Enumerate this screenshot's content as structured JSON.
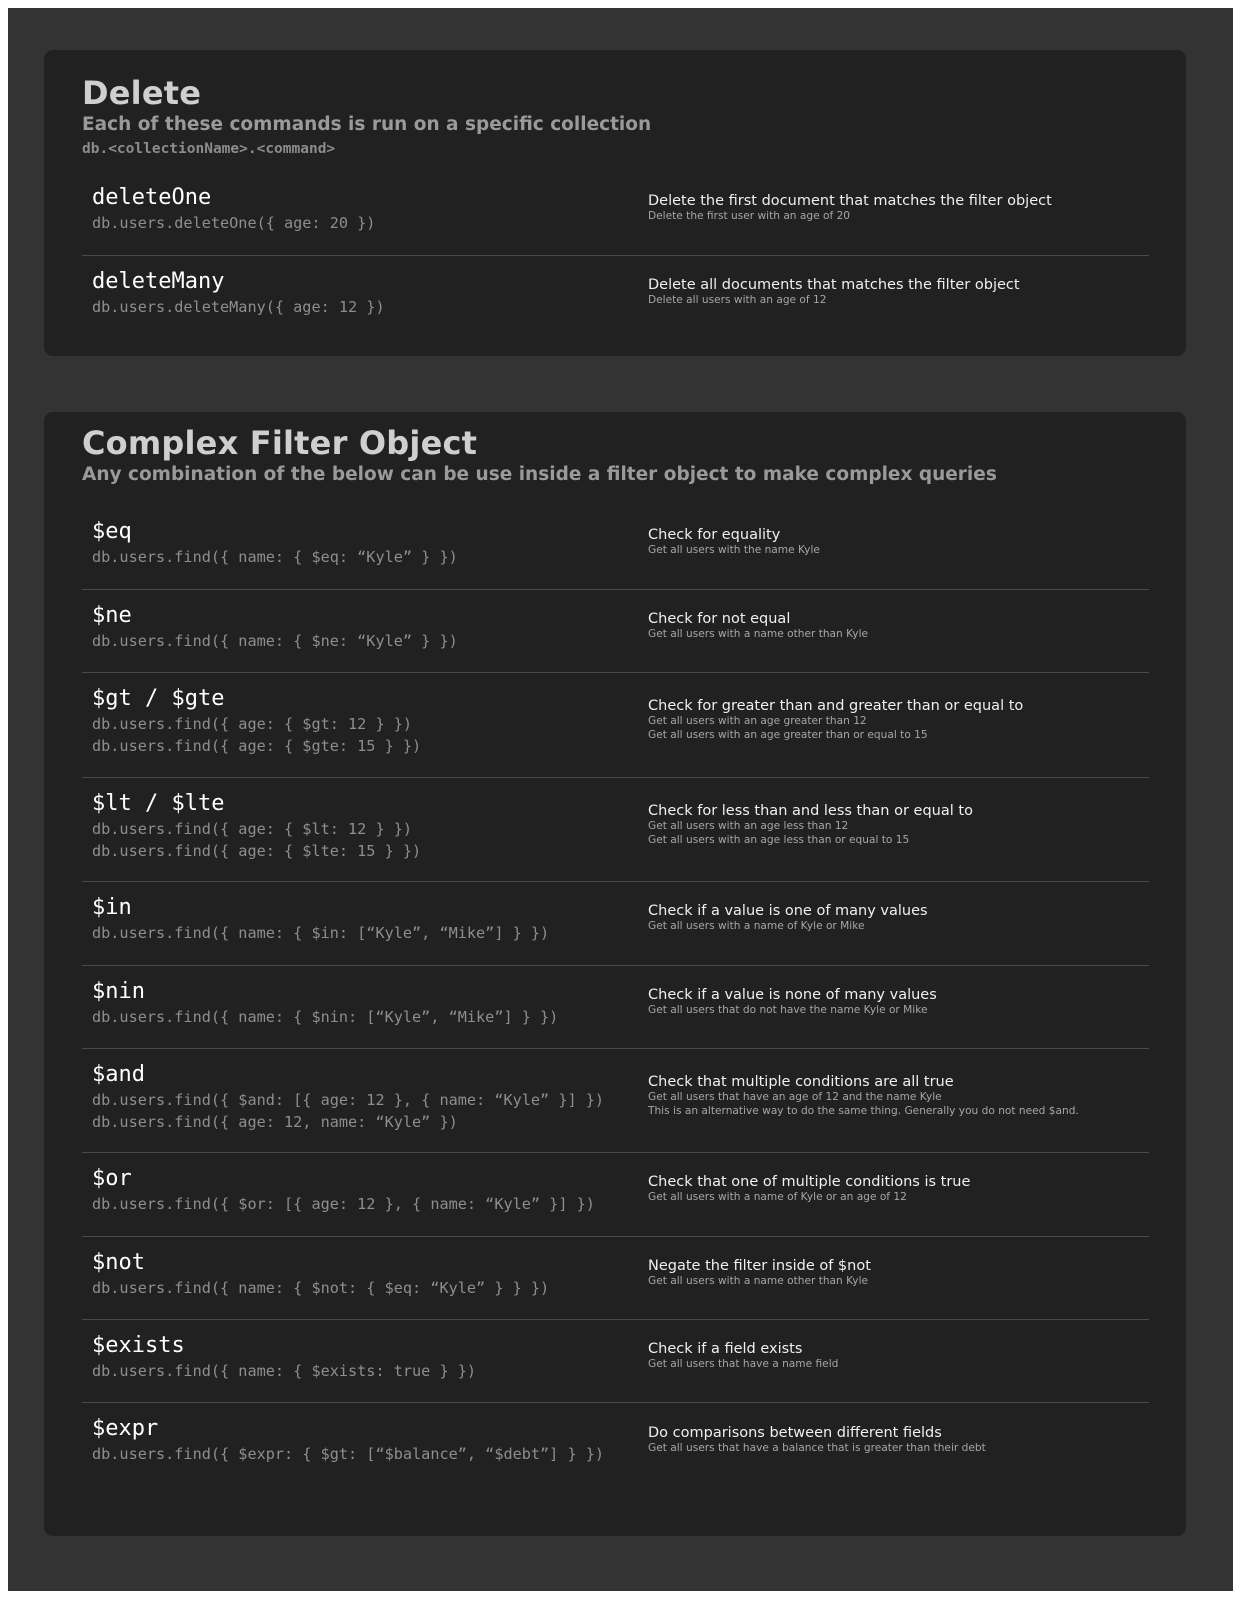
{
  "delete": {
    "title": "Delete",
    "subtitle": "Each of these commands is run on a specific collection",
    "syntax": "db.<collectionName>.<command>",
    "rows": [
      {
        "command": "deleteOne",
        "examples": [
          "db.users.deleteOne({ age: 20 })"
        ],
        "description": "Delete the first document that matches the filter object",
        "notes": [
          "Delete the first user with an age of 20"
        ]
      },
      {
        "command": "deleteMany",
        "examples": [
          "db.users.deleteMany({ age: 12 })"
        ],
        "description": "Delete all documents that matches the filter object",
        "notes": [
          "Delete all users with an age of 12"
        ]
      }
    ]
  },
  "filter": {
    "title": "Complex Filter Object",
    "subtitle": "Any combination of the below can be use inside a filter object to make complex queries",
    "rows": [
      {
        "command": "$eq",
        "examples": [
          "db.users.find({ name: { $eq: “Kyle” } })"
        ],
        "description": "Check for equality",
        "notes": [
          "Get all users with the name Kyle"
        ]
      },
      {
        "command": "$ne",
        "examples": [
          "db.users.find({ name: { $ne: “Kyle” } })"
        ],
        "description": "Check for not equal",
        "notes": [
          "Get all users with a name other than Kyle"
        ]
      },
      {
        "command": "$gt / $gte",
        "examples": [
          "db.users.find({ age: { $gt: 12 } })",
          "db.users.find({ age: { $gte: 15 } })"
        ],
        "description": "Check for greater than and greater than or equal to",
        "notes": [
          "Get all users with an age greater than 12",
          "Get all users with an age greater than or equal to 15"
        ]
      },
      {
        "command": "$lt / $lte",
        "examples": [
          "db.users.find({ age: { $lt: 12 } })",
          "db.users.find({ age: { $lte: 15 } })"
        ],
        "description": "Check for less than and less than or equal to",
        "notes": [
          "Get all users with an age less than 12",
          "Get all users with an age less than or equal to 15"
        ]
      },
      {
        "command": "$in",
        "examples": [
          "db.users.find({ name: { $in: [“Kyle”, “Mike”] } })"
        ],
        "description": "Check if a value is one of many values",
        "notes": [
          "Get all users with a name of Kyle or Mike"
        ]
      },
      {
        "command": "$nin",
        "examples": [
          "db.users.find({ name: { $nin: [“Kyle”, “Mike”] } })"
        ],
        "description": "Check if a value is none of many values",
        "notes": [
          "Get all users that do not have the name Kyle or Mike"
        ]
      },
      {
        "command": "$and",
        "examples": [
          "db.users.find({ $and: [{ age: 12 }, { name: “Kyle” }] })",
          "db.users.find({ age: 12, name: “Kyle” })"
        ],
        "description": "Check that multiple conditions are all true",
        "notes": [
          "Get all users that have an age of 12 and the name Kyle",
          "This is an alternative way to do the same thing. Generally you do not need $and."
        ]
      },
      {
        "command": "$or",
        "examples": [
          "db.users.find({ $or: [{ age: 12 }, { name: “Kyle” }] })"
        ],
        "description": "Check that one of multiple conditions is true",
        "notes": [
          "Get all users with a name of Kyle or an age of 12"
        ]
      },
      {
        "command": "$not",
        "examples": [
          "db.users.find({ name: { $not: { $eq: “Kyle” } } })"
        ],
        "description": "Negate the filter inside of $not",
        "notes": [
          "Get all users with a name other than Kyle"
        ]
      },
      {
        "command": "$exists",
        "examples": [
          "db.users.find({ name: { $exists: true } })"
        ],
        "description": "Check if a field exists",
        "notes": [
          "Get all users that have a name field"
        ]
      },
      {
        "command": "$expr",
        "examples": [
          "db.users.find({ $expr: { $gt: [“$balance”, “$debt”] } })"
        ],
        "description": "Do comparisons between different fields",
        "notes": [
          "Get all users that have a balance that is greater than their debt"
        ]
      }
    ]
  }
}
